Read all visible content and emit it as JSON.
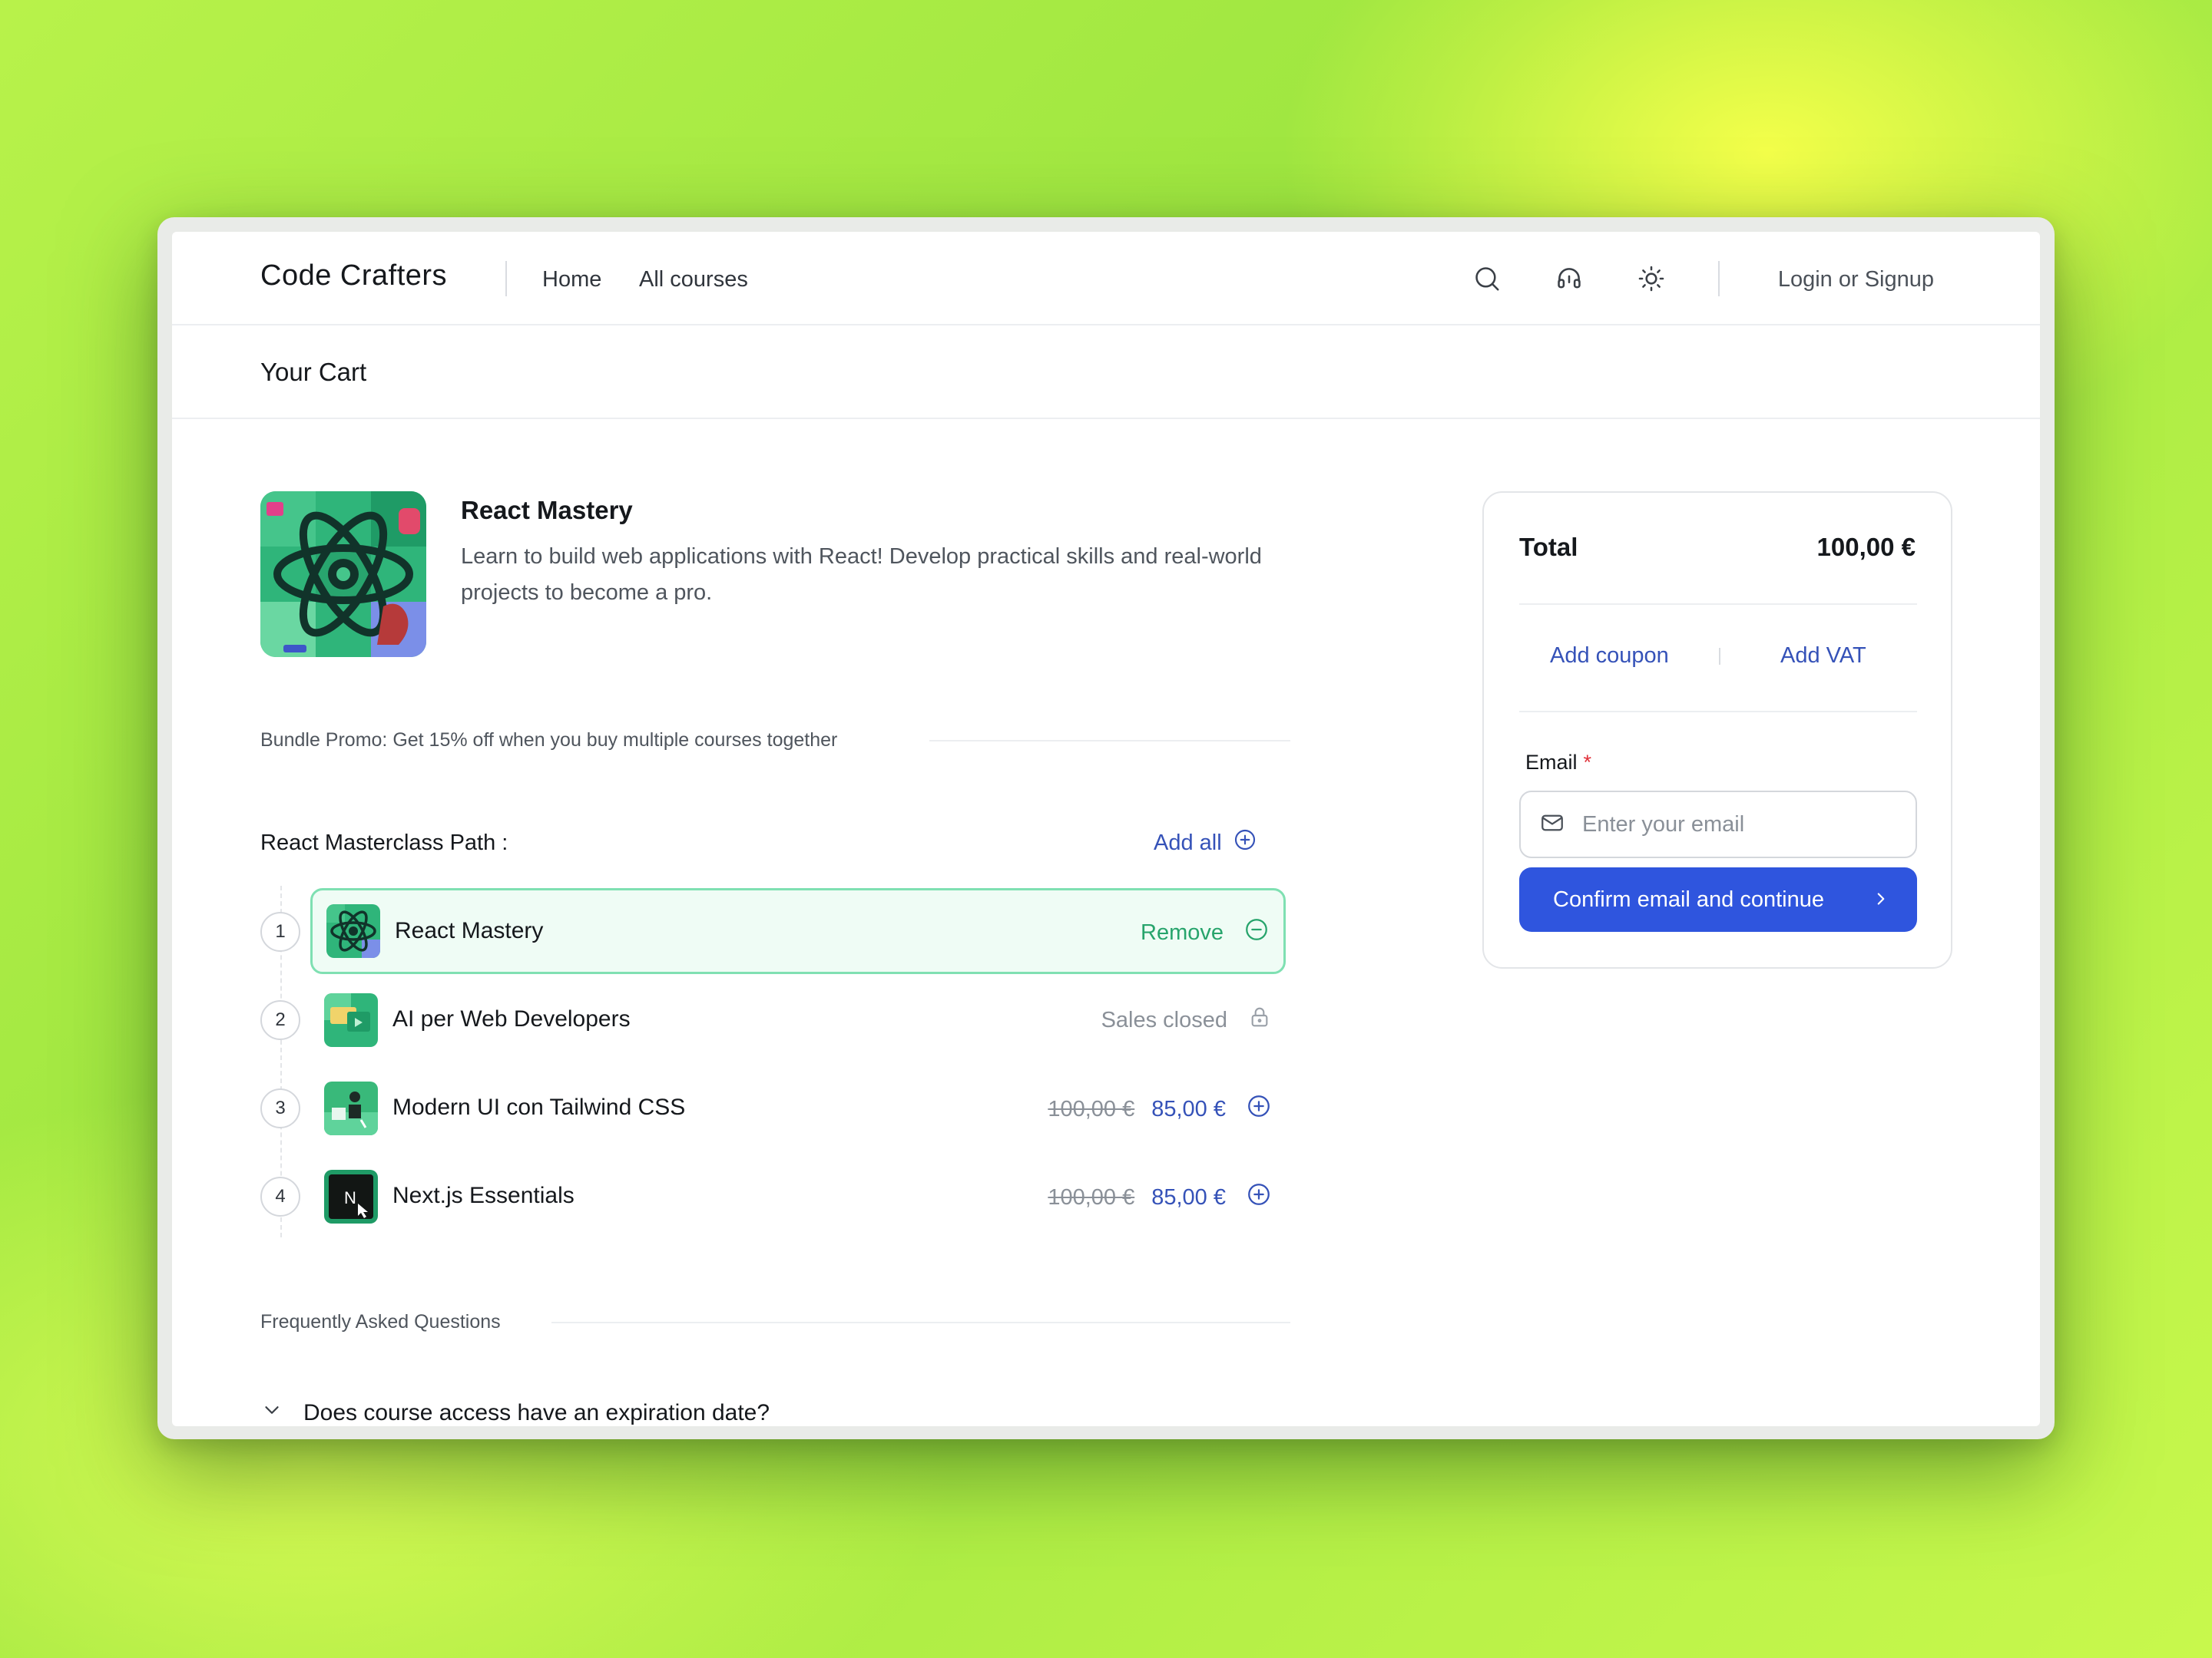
{
  "header": {
    "brand": "Code Crafters",
    "nav": [
      {
        "label": "Home"
      },
      {
        "label": "All courses"
      }
    ],
    "icons": [
      "search-icon",
      "headset-icon",
      "sun-icon"
    ],
    "login_label": "Login or Signup"
  },
  "page": {
    "title": "Your Cart"
  },
  "cart_item": {
    "title": "React Mastery",
    "description": "Learn to build web applications with React! Develop practical skills and real-world projects to become a pro."
  },
  "bundle": {
    "promo_text": "Bundle Promo: Get 15% off when you buy multiple courses together",
    "path_title": "React Masterclass Path :",
    "add_all_label": "Add all",
    "courses": [
      {
        "step": "1",
        "title": "React Mastery",
        "action_label": "Remove",
        "status": "in-cart"
      },
      {
        "step": "2",
        "title": "AI per Web Developers",
        "action_label": "Sales closed",
        "status": "closed"
      },
      {
        "step": "3",
        "title": "Modern UI con Tailwind CSS",
        "old_price": "100,00 €",
        "price": "85,00 €",
        "status": "available"
      },
      {
        "step": "4",
        "title": "Next.js Essentials",
        "old_price": "100,00 €",
        "price": "85,00 €",
        "status": "available"
      }
    ]
  },
  "faq": {
    "heading": "Frequently Asked Questions",
    "items": [
      {
        "question": "Does course access have an expiration date?"
      }
    ]
  },
  "summary": {
    "total_label": "Total",
    "total_value": "100,00 €",
    "add_coupon_label": "Add coupon",
    "add_vat_label": "Add VAT",
    "email_label": "Email",
    "email_required_mark": "*",
    "email_value": "",
    "email_placeholder": "Enter your email",
    "confirm_label": "Confirm email and continue"
  },
  "colors": {
    "accent_blue": "#2f55de",
    "link_blue": "#3552b8",
    "success_green": "#27a46c",
    "active_row_bg": "#effcf5",
    "active_row_border": "#7fe0b2"
  }
}
